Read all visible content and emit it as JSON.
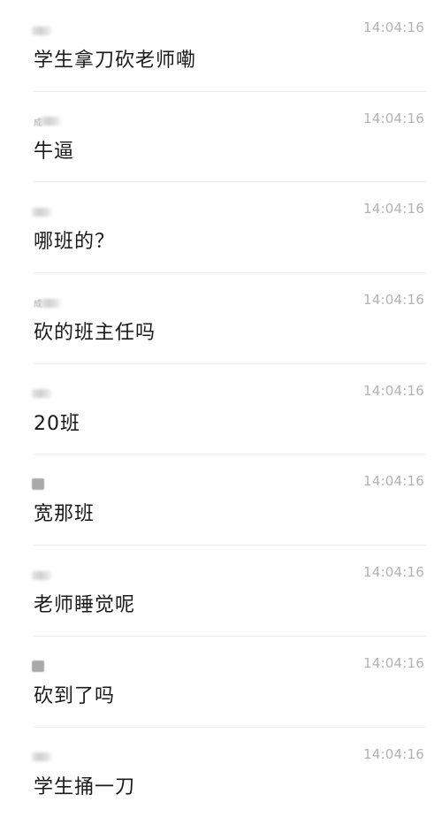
{
  "messages": [
    {
      "sender": "",
      "avatar_style": "blur",
      "time": "14:04:16",
      "text": "学生拿刀砍老师嘞"
    },
    {
      "sender": "成",
      "avatar_style": "blur",
      "time": "14:04:16",
      "text": "牛逼"
    },
    {
      "sender": "",
      "avatar_style": "blur",
      "time": "14:04:16",
      "text": "哪班的？"
    },
    {
      "sender": "成",
      "avatar_style": "blur",
      "time": "14:04:16",
      "text": "砍的班主任吗"
    },
    {
      "sender": "",
      "avatar_style": "blur",
      "time": "14:04:16",
      "text": "20班"
    },
    {
      "sender": "",
      "avatar_style": "square",
      "time": "14:04:16",
      "text": "宽那班"
    },
    {
      "sender": "",
      "avatar_style": "blur",
      "time": "14:04:16",
      "text": "老师睡觉呢"
    },
    {
      "sender": "",
      "avatar_style": "square",
      "time": "14:04:16",
      "text": "砍到了吗"
    },
    {
      "sender": "",
      "avatar_style": "blur",
      "time": "14:04:16",
      "text": "学生捅一刀"
    }
  ]
}
